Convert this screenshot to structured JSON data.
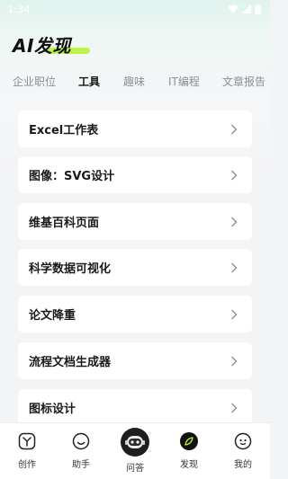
{
  "status_bar": {
    "time": "1:34"
  },
  "header": {
    "title": "AI发现"
  },
  "tabs": [
    {
      "label": "企业职位",
      "active": false
    },
    {
      "label": "工具",
      "active": true
    },
    {
      "label": "趣味",
      "active": false
    },
    {
      "label": "IT编程",
      "active": false
    },
    {
      "label": "文章报告",
      "active": false
    }
  ],
  "tools": [
    {
      "label": "Excel工作表"
    },
    {
      "label": "图像：SVG设计"
    },
    {
      "label": "维基百科页面"
    },
    {
      "label": "科学数据可视化"
    },
    {
      "label": "论文降重"
    },
    {
      "label": "流程文档生成器"
    },
    {
      "label": "图标设计"
    }
  ],
  "bottom_nav": [
    {
      "label": "创作",
      "icon": "create-icon"
    },
    {
      "label": "助手",
      "icon": "assistant-icon"
    },
    {
      "label": "问答",
      "icon": "robot-icon"
    },
    {
      "label": "发现",
      "icon": "discover-icon"
    },
    {
      "label": "我的",
      "icon": "profile-icon"
    }
  ],
  "colors": {
    "accent": "#b6f33a",
    "text": "#1a1a1a",
    "muted": "#8a8f98"
  }
}
